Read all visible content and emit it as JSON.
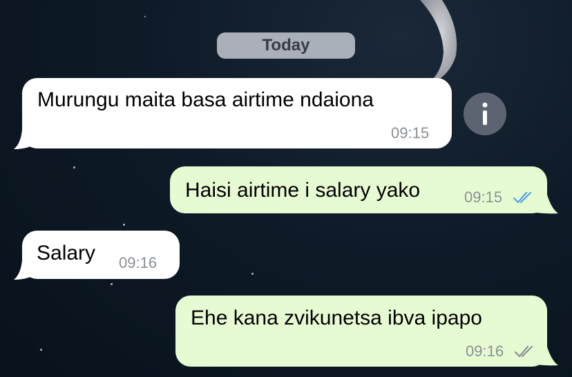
{
  "date_divider": "Today",
  "messages": [
    {
      "direction": "incoming",
      "text": "Murungu maita basa airtime ndaiona",
      "time": "09:15"
    },
    {
      "direction": "outgoing",
      "text": "Haisi airtime i salary yako",
      "time": "09:15",
      "status": "read"
    },
    {
      "direction": "incoming",
      "text": "Salary",
      "time": "09:16"
    },
    {
      "direction": "outgoing",
      "text": "Ehe kana zvikunetsa ibva ipapo",
      "time": "09:16",
      "status": "delivered"
    }
  ],
  "icons": {
    "info": "info-icon",
    "read_receipt": "double-check-icon"
  },
  "colors": {
    "incoming_bubble": "#ffffff",
    "outgoing_bubble": "#e7fbd3",
    "read_tick": "#4fa3e8",
    "delivered_tick": "#8a8f94",
    "date_pill": "#b7bcc4"
  }
}
